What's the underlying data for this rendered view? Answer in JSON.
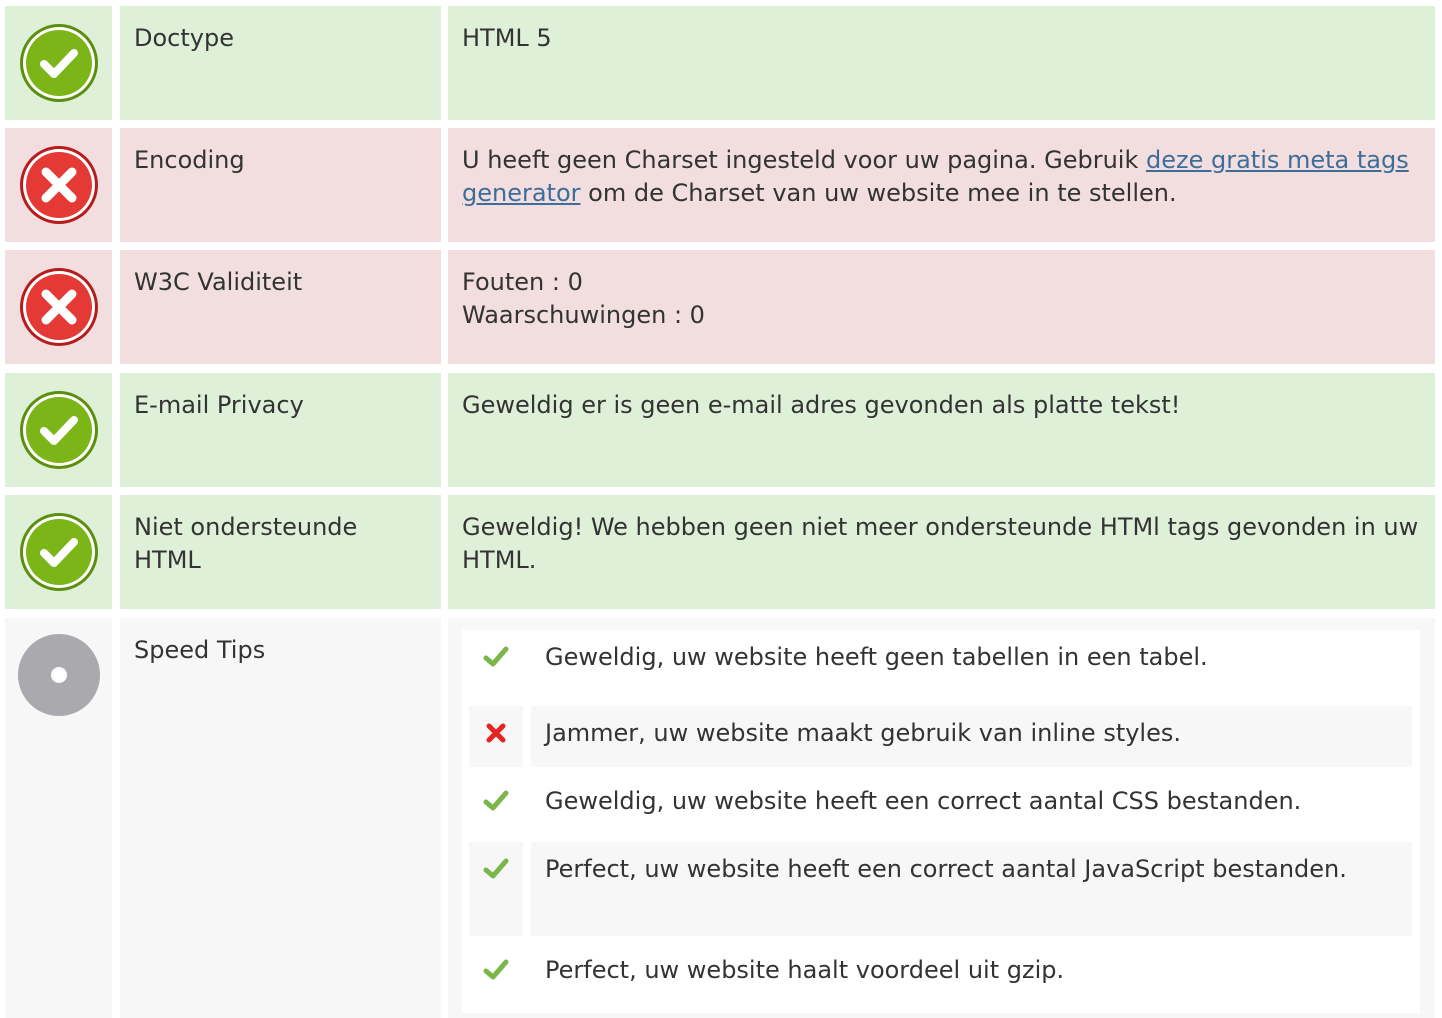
{
  "colors": {
    "ok_bg": "#dff0d8",
    "error_bg": "#f2dede",
    "neutral_bg": "#f7f7f7",
    "ok_icon": "#7cb518",
    "error_icon": "#e53935",
    "link": "#3d6e9b"
  },
  "rows": [
    {
      "status": "ok",
      "icon": "check-circle-icon",
      "label": "Doctype",
      "value": "HTML 5"
    },
    {
      "status": "error",
      "icon": "x-circle-icon",
      "label": "Encoding",
      "value_prefix": "U heeft geen Charset ingesteld voor uw pagina. Gebruik ",
      "link_text": "deze gratis meta tags generator",
      "value_suffix": " om de Charset van uw website mee in te stellen."
    },
    {
      "status": "error",
      "icon": "x-circle-icon",
      "label": "W3C Validiteit",
      "lines": [
        "Fouten : 0",
        "Waarschuwingen : 0"
      ]
    },
    {
      "status": "ok",
      "icon": "check-circle-icon",
      "label": "E-mail Privacy",
      "value": "Geweldig er is geen e-mail adres gevonden als platte tekst!"
    },
    {
      "status": "ok",
      "icon": "check-circle-icon",
      "label": "Niet ondersteunde HTML",
      "value": "Geweldig! We hebben geen niet meer ondersteunde HTMl tags gevonden in uw HTML."
    },
    {
      "status": "neutral",
      "icon": "info-circle-icon",
      "label": "Speed Tips"
    }
  ],
  "speed_tips": [
    {
      "status": "ok",
      "icon": "checkmark-icon",
      "text": "Geweldig, uw website heeft geen tabellen in een tabel."
    },
    {
      "status": "error",
      "icon": "cross-icon",
      "text": "Jammer, uw website maakt gebruik van inline styles."
    },
    {
      "status": "ok",
      "icon": "checkmark-icon",
      "text": "Geweldig, uw website heeft een correct aantal CSS bestanden."
    },
    {
      "status": "ok",
      "icon": "checkmark-icon",
      "text": "Perfect, uw website heeft een correct aantal JavaScript bestanden."
    },
    {
      "status": "ok",
      "icon": "checkmark-icon",
      "text": "Perfect, uw website haalt voordeel uit gzip."
    }
  ]
}
